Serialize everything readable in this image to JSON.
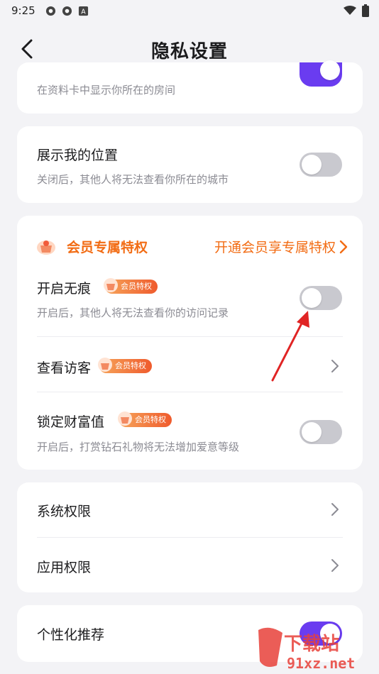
{
  "status_bar": {
    "time": "9:25",
    "icons": [
      "settings-gear-icon",
      "settings-gear-icon",
      "notification-a-icon"
    ],
    "right_icons": [
      "wifi-icon",
      "battery-icon"
    ]
  },
  "header": {
    "title": "隐私设置",
    "back_icon": "back-arrow-icon"
  },
  "sections": {
    "room": {
      "desc": "在资料卡中显示你所在的房间",
      "toggle_on": true
    },
    "location": {
      "title": "展示我的位置",
      "desc": "关闭后，其他人将无法查看你所在的城市",
      "toggle_on": false
    },
    "vip": {
      "title": "会员专属特权",
      "link": "开通会员享专属特权",
      "items": [
        {
          "title": "开启无痕",
          "badge": "会员特权",
          "desc": "开启后，其他人将无法查看你的访问记录",
          "toggle_on": false
        },
        {
          "title": "查看访客",
          "badge": "会员特权"
        },
        {
          "title": "锁定财富值",
          "badge": "会员特权",
          "desc": "开启后，打赏钻石礼物将无法增加爱意等级",
          "toggle_on": false
        }
      ]
    },
    "permissions": {
      "items": [
        {
          "title": "系统权限"
        },
        {
          "title": "应用权限"
        }
      ]
    },
    "recommend": {
      "title": "个性化推荐",
      "toggle_on": true
    }
  },
  "colors": {
    "accent": "#6a3cf0",
    "vip_orange": "#f26c14",
    "toggle_off": "#c9c9cf",
    "background": "#f3f3f6"
  }
}
